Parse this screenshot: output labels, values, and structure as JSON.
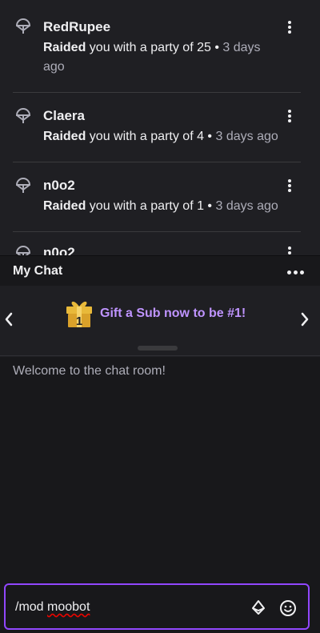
{
  "feed": {
    "items": [
      {
        "name": "RedRupee",
        "action": "Raided",
        "text": " you with a party of 25",
        "dot": " • ",
        "time_a": "3 days",
        "time_b": "ago"
      },
      {
        "name": "Claera",
        "action": "Raided",
        "text": " you with a party of 4",
        "dot": " • ",
        "time": "3 days ago"
      },
      {
        "name": "n0o2",
        "action": "Raided",
        "text": " you with a party of 1",
        "dot": " • ",
        "time": "3 days ago"
      },
      {
        "name": "n0o2"
      }
    ]
  },
  "chat": {
    "title": "My Chat",
    "promo": "Gift a Sub now to be #1!",
    "promo_badge": "1",
    "welcome": "Welcome to the chat room!",
    "input_cmd": "/mod ",
    "input_arg": "moobot"
  },
  "colors": {
    "accent": "#9147ff",
    "promo_text": "#bf94ff",
    "background": "#1f1f23"
  }
}
